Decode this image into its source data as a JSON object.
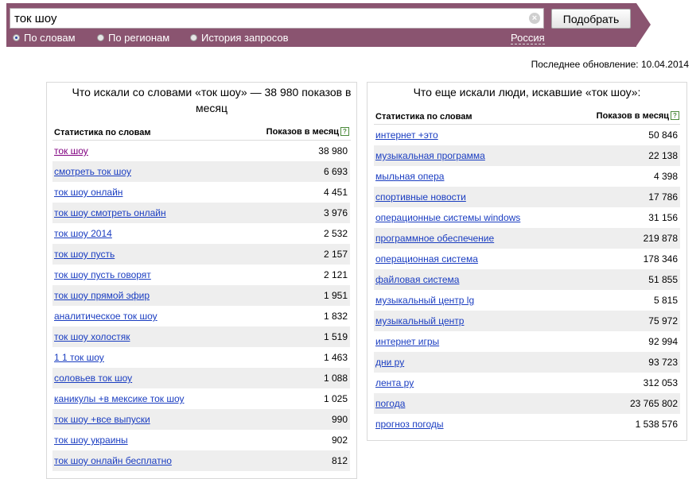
{
  "search": {
    "query": "ток шоу",
    "submit_label": "Подобрать"
  },
  "modes": [
    {
      "label": "По словам",
      "checked": true
    },
    {
      "label": "По регионам",
      "checked": false
    },
    {
      "label": "История запросов",
      "checked": false
    }
  ],
  "region": "Россия",
  "last_update": "Последнее обновление: 10.04.2014",
  "left": {
    "title": "Что искали со словами «ток шоу» — 38 980 показов в месяц",
    "col_keyword": "Статистика по словам",
    "col_count": "Показов в месяц",
    "rows": [
      {
        "keyword": "ток шоу",
        "count": "38 980"
      },
      {
        "keyword": "смотреть ток шоу",
        "count": "6 693"
      },
      {
        "keyword": "ток шоу онлайн",
        "count": "4 451"
      },
      {
        "keyword": "ток шоу смотреть онлайн",
        "count": "3 976"
      },
      {
        "keyword": "ток шоу 2014",
        "count": "2 532"
      },
      {
        "keyword": "ток шоу пусть",
        "count": "2 157"
      },
      {
        "keyword": "ток шоу пусть говорят",
        "count": "2 121"
      },
      {
        "keyword": "ток шоу прямой эфир",
        "count": "1 951"
      },
      {
        "keyword": "аналитическое ток шоу",
        "count": "1 832"
      },
      {
        "keyword": "ток шоу холостяк",
        "count": "1 519"
      },
      {
        "keyword": "1 1 ток шоу",
        "count": "1 463"
      },
      {
        "keyword": "соловьев ток шоу",
        "count": "1 088"
      },
      {
        "keyword": "каникулы +в мексике ток шоу",
        "count": "1 025"
      },
      {
        "keyword": "ток шоу +все выпуски",
        "count": "990"
      },
      {
        "keyword": "ток шоу украины",
        "count": "902"
      },
      {
        "keyword": "ток шоу онлайн бесплатно",
        "count": "812"
      }
    ]
  },
  "right": {
    "title": "Что еще искали люди, искавшие «ток шоу»:",
    "col_keyword": "Статистика по словам",
    "col_count": "Показов в месяц",
    "rows": [
      {
        "keyword": "интернет +это",
        "count": "50 846"
      },
      {
        "keyword": "музыкальная программа",
        "count": "22 138"
      },
      {
        "keyword": "мыльная опера",
        "count": "4 398"
      },
      {
        "keyword": "спортивные новости",
        "count": "17 786"
      },
      {
        "keyword": "операционные системы windows",
        "count": "31 156"
      },
      {
        "keyword": "программное обеспечение",
        "count": "219 878"
      },
      {
        "keyword": "операционная система",
        "count": "178 346"
      },
      {
        "keyword": "файловая система",
        "count": "51 855"
      },
      {
        "keyword": "музыкальный центр lg",
        "count": "5 815"
      },
      {
        "keyword": "музыкальный центр",
        "count": "75 972"
      },
      {
        "keyword": "интернет игры",
        "count": "92 994"
      },
      {
        "keyword": "дни ру",
        "count": "93 723"
      },
      {
        "keyword": "лента ру",
        "count": "312 053"
      },
      {
        "keyword": "погода",
        "count": "23 765 802"
      },
      {
        "keyword": "прогноз погоды",
        "count": "1 538 576"
      }
    ]
  },
  "colors": {
    "bar": "#8a5470",
    "link": "#1a3dc1",
    "visited": "#800080",
    "alt_row": "#eeeeee"
  },
  "icons": {
    "clear": "clear-icon",
    "help": "help-icon"
  }
}
